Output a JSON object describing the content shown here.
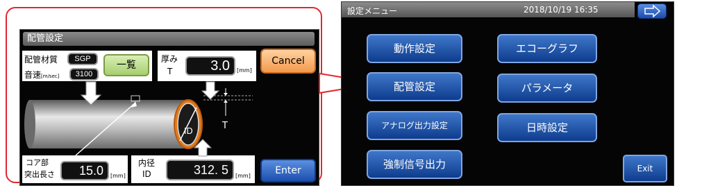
{
  "pipe_settings": {
    "title": "配管設定",
    "material_label": "配管材質",
    "material_value": "SGP",
    "sound_speed_label": "音速",
    "sound_speed_unit": "[m/sec]",
    "sound_speed_value": "3100",
    "list_button": "一覧",
    "thickness_label_line1": "厚み",
    "thickness_label_line2": "T",
    "thickness_value": "3.0",
    "thickness_unit": "[mm]",
    "cancel_button": "Cancel",
    "core_label_line1": "コア部",
    "core_label_line2": "突出長さ",
    "core_value": "15.0",
    "core_unit": "[mm]",
    "id_label_line1": "内径",
    "id_label_line2": "ID",
    "id_value": "312. 5",
    "id_unit": "[mm]",
    "enter_button": "Enter",
    "diagram_id_text": "ID",
    "diagram_t_text": "T"
  },
  "menu": {
    "title": "設定メニュー",
    "datetime": "2018/10/19  16:35",
    "buttons": {
      "operation": "動作設定",
      "echo_graph": "エコーグラフ",
      "pipe": "配管設定",
      "parameter": "パラメータ",
      "analog": "アナログ出力設定",
      "datetime": "日時設定",
      "forced": "強制信号出力"
    },
    "exit_button": "Exit"
  },
  "colors": {
    "callout": "#e0282f",
    "menu_button": "#1d52b0",
    "cancel": "#f39a4c",
    "list_button": "#a6cf6f"
  }
}
